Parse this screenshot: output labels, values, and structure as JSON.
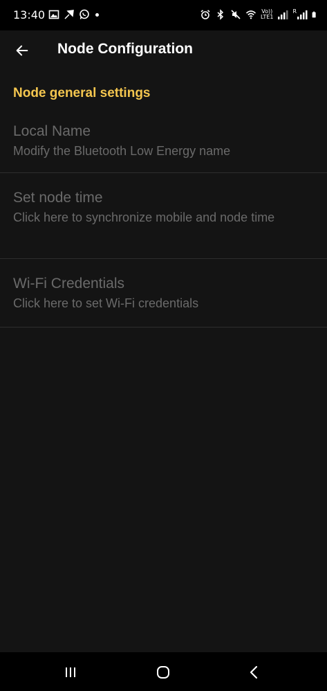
{
  "status_bar": {
    "time": "13:40",
    "left_icons": [
      "gallery-icon",
      "feather-icon",
      "whatsapp-icon",
      "dot-icon"
    ],
    "right_icons": [
      "alarm-icon",
      "bluetooth-icon",
      "mute-icon",
      "wifi-icon",
      "volte-icon",
      "signal-icon",
      "signal-r-icon",
      "battery-icon"
    ],
    "volte_line1": "Vo))",
    "volte_line2": "LTE1",
    "roaming_label": "R"
  },
  "app_bar": {
    "title": "Node Configuration",
    "back_icon": "arrow-left-icon"
  },
  "settings": {
    "section_title": "Node general settings",
    "items": [
      {
        "title": "Local Name",
        "summary": "Modify the Bluetooth Low Energy name"
      },
      {
        "title": "Set node time",
        "summary": "Click here to synchronize mobile and node time"
      },
      {
        "title": "Wi-Fi Credentials",
        "summary": "Click here to set Wi-Fi credentials"
      }
    ]
  },
  "colors": {
    "background": "#141414",
    "accent": "#f4c64f",
    "disabled_text": "#6a6a6a",
    "divider": "#2e2e2e"
  },
  "nav_bar": {
    "buttons": [
      "recent-apps-icon",
      "home-icon",
      "back-icon"
    ]
  }
}
